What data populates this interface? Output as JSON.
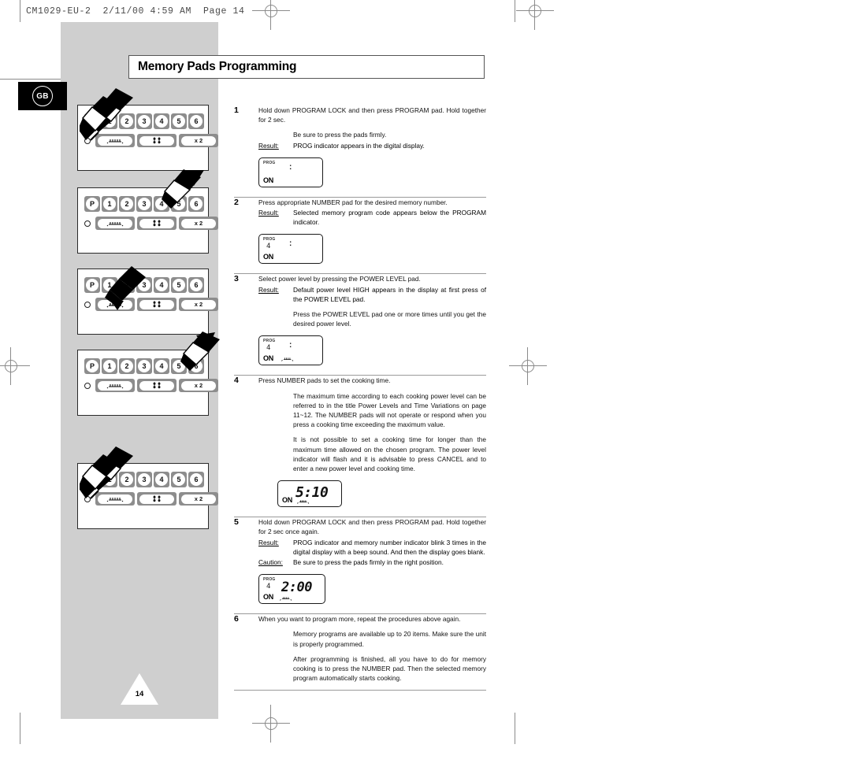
{
  "file_header": "CM1029-EU-2  2/11/00 4:59 AM  Page 14",
  "language_badge": "GB",
  "page_title": "Memory Pads Programming",
  "page_number": "14",
  "keypad": {
    "program_key": "P",
    "number_keys": [
      "1",
      "2",
      "3",
      "4",
      "5",
      "6"
    ],
    "oval_buttons": [
      "power-level-icon",
      "defrost-icon",
      "x 2"
    ],
    "multiplier_label": "x 2"
  },
  "steps": [
    {
      "number": "1",
      "lead": "Hold down PROGRAM LOCK and then press PROGRAM pad. Hold together for 2 sec.",
      "note": "Be sure to press the pads firmly.",
      "result_label": "Result:",
      "result_text": "PROG indicator appears in the digital display.",
      "display": {
        "prog": "PROG",
        "memory_number": "",
        "on": "ON",
        "colon": true,
        "time": "",
        "power_icon": false
      }
    },
    {
      "number": "2",
      "lead": "Press appropriate NUMBER pad for the desired memory number.",
      "result_label": "Result:",
      "result_text": "Selected memory program code appears below the PROGRAM indicator.",
      "display": {
        "prog": "PROG",
        "memory_number": "4",
        "on": "ON",
        "colon": true,
        "time": "",
        "power_icon": false
      }
    },
    {
      "number": "3",
      "lead": "Select power level by pressing the POWER LEVEL pad.",
      "result_label": "Result:",
      "result_text": "Default power level HIGH appears in the display at first press of the POWER LEVEL pad.",
      "extra": "Press the POWER LEVEL pad one or more times until you get the desired power level.",
      "display": {
        "prog": "PROG",
        "memory_number": "4",
        "on": "ON",
        "colon": true,
        "time": "",
        "power_icon": true
      }
    },
    {
      "number": "4",
      "lead": "Press NUMBER pads to set the cooking time.",
      "body1": "The maximum time according to each cooking power level can be referred to in the title  Power Levels and Time Variations  on page 11~12. The NUMBER pads will not operate or respond when you press a cooking time exceeding the maximum value.",
      "body2": "It is not possible to set a cooking time for longer than the maximum time allowed on the chosen program. The power level indicator will flash and it is advisable to press CANCEL and to enter a new power level and cooking time.",
      "display": {
        "prog": "",
        "memory_number": "",
        "on": "ON",
        "colon": false,
        "time": "5:10",
        "power_icon": true
      }
    },
    {
      "number": "5",
      "lead": "Hold down PROGRAM LOCK and then press PROGRAM pad. Hold together for 2 sec once again.",
      "result_label": "Result:",
      "result_text": "PROG indicator and memory number indicator blink 3 times in the digital display with a beep sound. And then the display goes blank.",
      "caution_label": "Caution:",
      "caution_text": "Be sure to press the pads firmly in the right position.",
      "display": {
        "prog": "PROG",
        "memory_number": "4",
        "on": "ON",
        "colon": false,
        "time": "2:00",
        "power_icon": true
      }
    },
    {
      "number": "6",
      "lead": "When you want to program more, repeat the procedures above again.",
      "body1": "Memory programs are available up to 20 items. Make sure the unit is properly programmed.",
      "body2": "After programming is finished, all you have to do for memory cooking is to press the NUMBER pad. Then the selected memory program automatically starts cooking."
    }
  ],
  "illustrations": [
    {
      "id": "panel-1",
      "highlighted_keys": [
        "P",
        "1"
      ],
      "arrows": 2,
      "target": "program-lock-and-program"
    },
    {
      "id": "panel-2",
      "highlighted_keys": [
        "4"
      ],
      "arrows": 1,
      "target": "number-pad-4"
    },
    {
      "id": "panel-3",
      "highlighted_keys": [
        "power-level"
      ],
      "arrows": 1,
      "target": "power-level-pad"
    },
    {
      "id": "panel-4",
      "highlighted_keys": [
        "5"
      ],
      "arrows": 1,
      "target": "number-pad-5"
    },
    {
      "id": "panel-5",
      "highlighted_keys": [
        "P",
        "1"
      ],
      "arrows": 2,
      "target": "program-lock-and-program"
    }
  ],
  "colors": {
    "grey_panel": "#cfcfcf",
    "key_body": "#8d8d8d",
    "badge_bg": "#000000",
    "rule": "#9a9a9a"
  }
}
